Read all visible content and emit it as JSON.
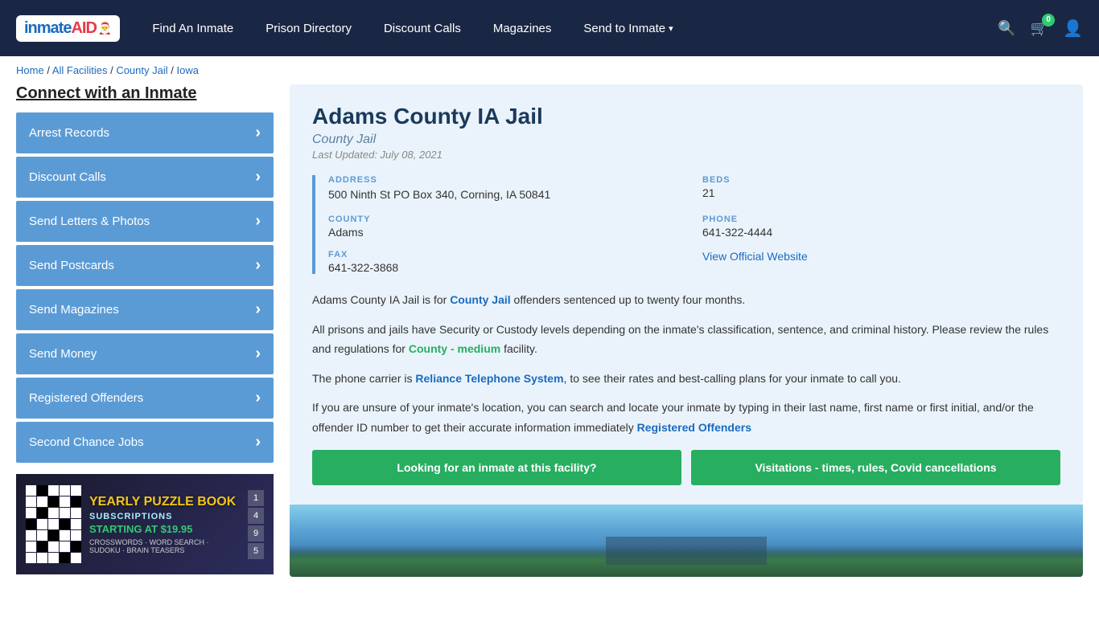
{
  "navbar": {
    "logo": "inmateAID",
    "logo_main": "inmate",
    "logo_aid": "AID",
    "nav_items": [
      {
        "label": "Find An Inmate",
        "id": "find-inmate"
      },
      {
        "label": "Prison Directory",
        "id": "prison-directory"
      },
      {
        "label": "Discount Calls",
        "id": "discount-calls"
      },
      {
        "label": "Magazines",
        "id": "magazines"
      },
      {
        "label": "Send to Inmate",
        "id": "send-to-inmate",
        "has_dropdown": true
      }
    ],
    "cart_count": "0",
    "search_placeholder": "Search"
  },
  "breadcrumb": {
    "items": [
      {
        "label": "Home",
        "href": "#"
      },
      {
        "label": "All Facilities",
        "href": "#"
      },
      {
        "label": "County Jail",
        "href": "#"
      },
      {
        "label": "Iowa",
        "href": "#"
      }
    ]
  },
  "sidebar": {
    "title": "Connect with an Inmate",
    "items": [
      {
        "label": "Arrest Records",
        "id": "arrest-records"
      },
      {
        "label": "Discount Calls",
        "id": "discount-calls"
      },
      {
        "label": "Send Letters & Photos",
        "id": "send-letters"
      },
      {
        "label": "Send Postcards",
        "id": "send-postcards"
      },
      {
        "label": "Send Magazines",
        "id": "send-magazines"
      },
      {
        "label": "Send Money",
        "id": "send-money"
      },
      {
        "label": "Registered Offenders",
        "id": "registered-offenders"
      },
      {
        "label": "Second Chance Jobs",
        "id": "second-chance-jobs"
      }
    ],
    "ad": {
      "title": "YEARLY PUZZLE BOOK",
      "subtitle": "SUBSCRIPTIONS",
      "price": "STARTING AT $19.95",
      "bottom_text": "CROSSWORDS · WORD SEARCH · SUDOKU · BRAIN TEASERS"
    }
  },
  "facility": {
    "name": "Adams County IA Jail",
    "type": "County Jail",
    "last_updated": "Last Updated: July 08, 2021",
    "address_label": "ADDRESS",
    "address_value": "500 Ninth St PO Box 340, Corning, IA 50841",
    "beds_label": "BEDS",
    "beds_value": "21",
    "county_label": "COUNTY",
    "county_value": "Adams",
    "phone_label": "PHONE",
    "phone_value": "641-322-4444",
    "fax_label": "FAX",
    "fax_value": "641-322-3868",
    "website_label": "View Official Website",
    "desc1": "Adams County IA Jail is for ",
    "desc1_link": "County Jail",
    "desc1_rest": " offenders sentenced up to twenty four months.",
    "desc2": "All prisons and jails have Security or Custody levels depending on the inmate's classification, sentence, and criminal history. Please review the rules and regulations for ",
    "desc2_link": "County - medium",
    "desc2_rest": " facility.",
    "desc3": "The phone carrier is ",
    "desc3_link": "Reliance Telephone System",
    "desc3_rest": ", to see their rates and best-calling plans for your inmate to call you.",
    "desc4": "If you are unsure of your inmate's location, you can search and locate your inmate by typing in their last name, first name or first initial, and/or the offender ID number to get their accurate information immediately ",
    "desc4_link": "Registered Offenders",
    "btn1": "Looking for an inmate at this facility?",
    "btn2": "Visitations - times, rules, Covid cancellations"
  }
}
